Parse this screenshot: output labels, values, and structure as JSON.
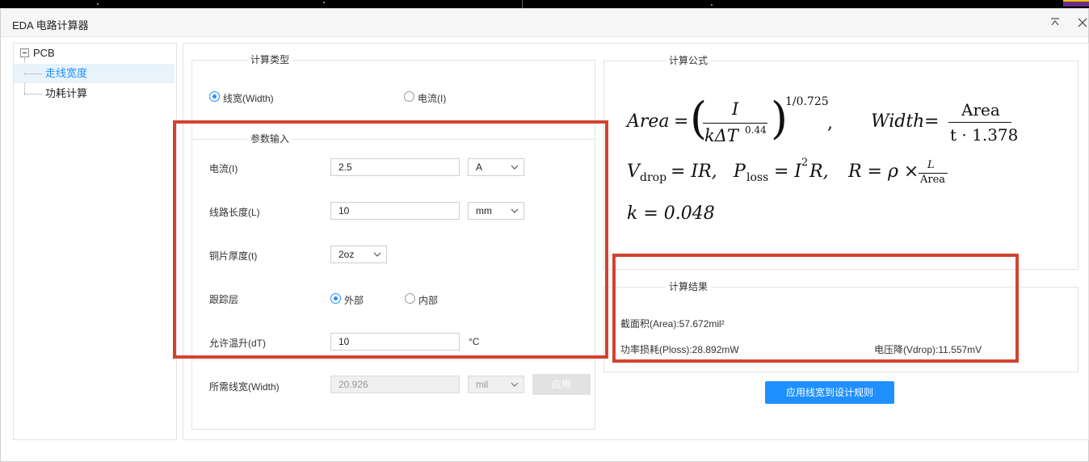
{
  "window": {
    "title": "EDA 电路计算器"
  },
  "tree": {
    "root": "PCB",
    "items": [
      "走线宽度",
      "功耗计算"
    ],
    "selected": 0
  },
  "calc_type": {
    "legend": "计算类型",
    "options": [
      {
        "label": "线宽(Width)",
        "selected": true
      },
      {
        "label": "电流(I)",
        "selected": false
      }
    ]
  },
  "params": {
    "legend": "参数输入",
    "current": {
      "label": "电流(I)",
      "value": "2.5",
      "unit": "A"
    },
    "length": {
      "label": "线路长度(L)",
      "value": "10",
      "unit": "mm"
    },
    "thickness": {
      "label": "铜片厚度(t)",
      "value": "2oz"
    },
    "layer": {
      "label": "跟踪层",
      "options": [
        {
          "label": "外部",
          "selected": true
        },
        {
          "label": "内部",
          "selected": false
        }
      ]
    },
    "temp_rise": {
      "label": "允许温升(dT)",
      "value": "10",
      "unit": "°C"
    }
  },
  "required_width": {
    "label": "所需线宽(Width)",
    "value": "20.926",
    "unit": "mil",
    "apply_label": "应用"
  },
  "formula": {
    "legend": "计算公式",
    "area_lhs": "Area",
    "area_num": "I",
    "area_den_base": "kΔT",
    "area_den_exp": "0.44",
    "area_exp": "1/0.725",
    "width_lhs": "Width",
    "width_num": "Area",
    "width_den": "t · 1.378",
    "vdrop": "V",
    "vdrop_sub": "drop",
    "vdrop_rhs": "= IR,",
    "ploss": "P",
    "ploss_sub": "loss",
    "ploss_rhs_a": "= I",
    "ploss_rhs_exp": "2",
    "ploss_rhs_b": "R,",
    "r_expr": "R = ρ ×",
    "r_num": "L",
    "r_den": "Area",
    "k_expr": "k = 0.048"
  },
  "results": {
    "legend": "计算结果",
    "area": "截面积(Area):57.672mil²",
    "ploss": "功率损耗(Ploss):28.892mW",
    "vdrop": "电压降(Vdrop):11.557mV"
  },
  "apply_rule_button": "应用线宽到设计规则",
  "colors": {
    "accent": "#1e90ff",
    "highlight": "#d2432e"
  }
}
